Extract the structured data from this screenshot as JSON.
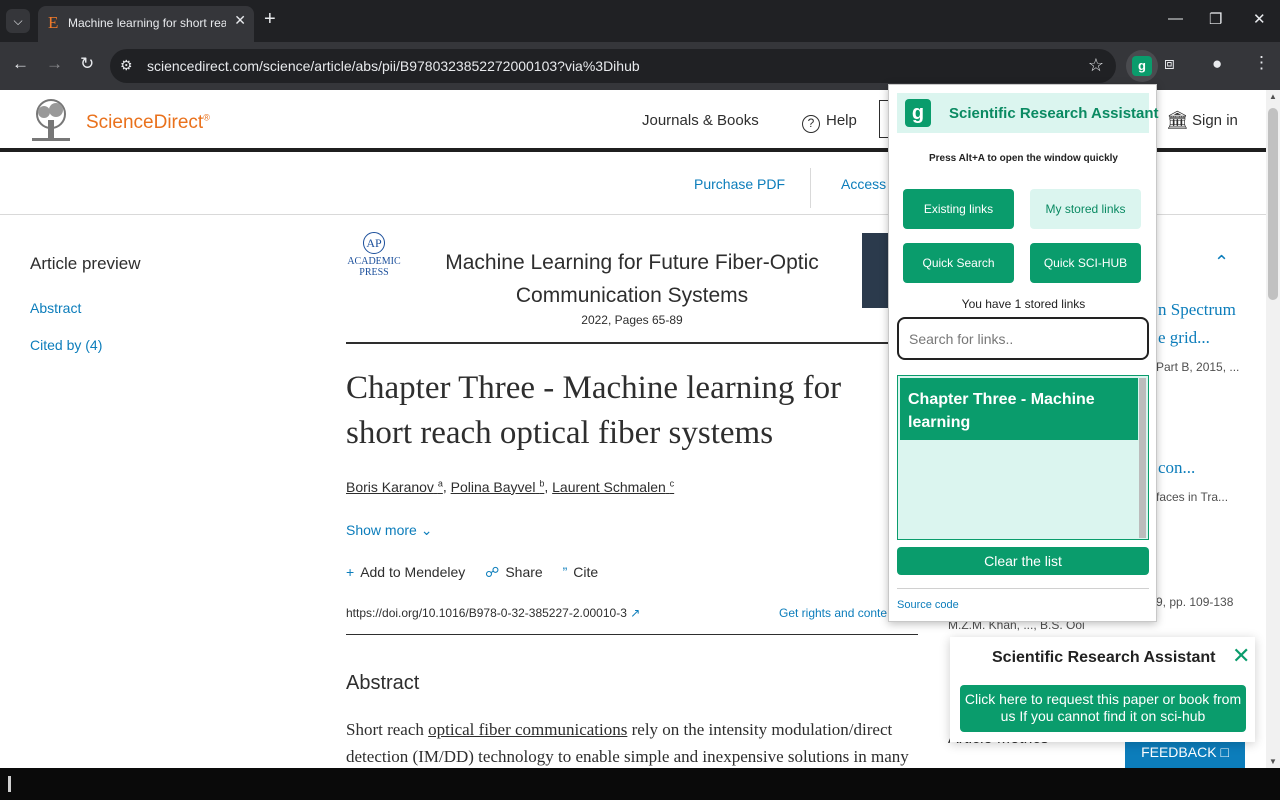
{
  "browser": {
    "tab_title": "Machine learning for short reach",
    "tab_favicon": "E",
    "url": "sciencedirect.com/science/article/abs/pii/B9780323852272000103?via%3Dihub",
    "extension_letter": "g"
  },
  "site": {
    "logo_text": "ScienceDirect",
    "logo_reg": "®",
    "nav": {
      "journals": "Journals & Books",
      "help": "Help",
      "sign_in": "Sign in"
    },
    "purchase_pdf": "Purchase PDF",
    "access": "Access t"
  },
  "sidebar": {
    "title": "Article preview",
    "links": [
      "Abstract",
      "Cited by (4)"
    ]
  },
  "book": {
    "publisher_line1": "ACADEMIC",
    "publisher_line2": "PRESS",
    "publisher_mark": "AP",
    "title": "Machine Learning for Future Fiber-Optic Communication Systems",
    "subtitle": "2022, Pages 65-89"
  },
  "article": {
    "title": "Chapter Three - Machine learning for short reach optical fiber systems",
    "authors": [
      {
        "name": "Boris Karanov",
        "sup": "a"
      },
      {
        "name": "Polina Bayvel",
        "sup": "b"
      },
      {
        "name": "Laurent Schmalen",
        "sup": "c"
      }
    ],
    "show_more": "Show more",
    "actions": {
      "mendeley": "Add to Mendeley",
      "share": "Share",
      "cite": "Cite"
    },
    "doi": "https://doi.org/10.1016/B978-0-32-385227-2.00010-3",
    "rights": "Get rights and conte",
    "abstract_heading": "Abstract",
    "abstract_pre": "Short reach ",
    "abstract_link": "optical fiber communications",
    "abstract_post": " rely on the intensity modulation/direct detection (IM/DD) technology to enable simple and inexpensive solutions in many"
  },
  "right_column": {
    "frag1": "n Spectrum",
    "frag2": "e grid...",
    "meta1": "Part B, 2015, ...",
    "frag3": "con...",
    "meta2": "faces in Tra...",
    "meta3": "9, pp. 109-138",
    "meta4": "M.Z.M. Khan, ..., B.S. Ooi",
    "metrics": "Article Metrics",
    "feedback": "FEEDBACK"
  },
  "popup": {
    "logo": "g",
    "title": "Scientific Research Assistant",
    "hint": "Press Alt+A to open the window quickly",
    "buttons": {
      "existing": "Existing links",
      "stored": "My stored links",
      "quick_search": "Quick Search",
      "quick_scihub": "Quick SCI-HUB"
    },
    "count": "You have 1 stored links",
    "search_placeholder": "Search for links..",
    "items": [
      "Chapter Three - Machine learning"
    ],
    "clear": "Clear the list",
    "source": "Source code"
  },
  "toast": {
    "title": "Scientific Research Assistant",
    "button": "Click here to request this paper or book from us If you cannot find it on sci-hub"
  },
  "colors": {
    "brand_green": "#0a9c6c",
    "link_blue": "#0c7dbb",
    "sd_orange": "#e9711c"
  }
}
